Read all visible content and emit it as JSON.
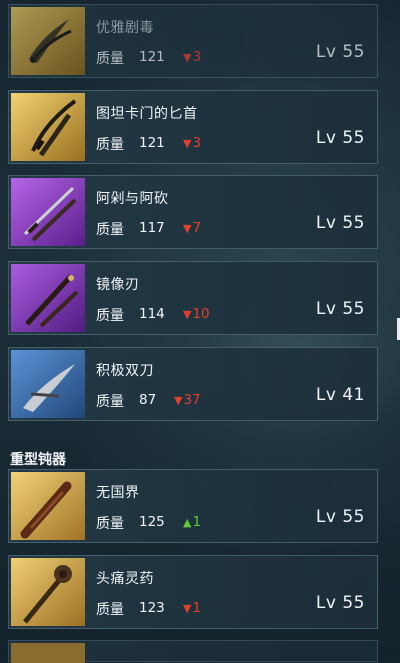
{
  "quality_label": "质量",
  "section_heavy_blunt": "重型钝器",
  "items": [
    {
      "name": "优雅剧毒",
      "quality": "121",
      "delta": "3",
      "delta_dir": "down",
      "level": "Lv 55",
      "rarity": "gold",
      "icon": "curved-dagger-icon"
    },
    {
      "name": "图坦卡门的匕首",
      "quality": "121",
      "delta": "3",
      "delta_dir": "down",
      "level": "Lv 55",
      "rarity": "gold",
      "icon": "twin-daggers-icon"
    },
    {
      "name": "阿剁与阿砍",
      "quality": "117",
      "delta": "7",
      "delta_dir": "down",
      "level": "Lv 55",
      "rarity": "purple",
      "icon": "twin-daggers-icon"
    },
    {
      "name": "镜像刃",
      "quality": "114",
      "delta": "10",
      "delta_dir": "down",
      "level": "Lv 55",
      "rarity": "purple",
      "icon": "twin-daggers-icon"
    },
    {
      "name": "积极双刀",
      "quality": "87",
      "delta": "37",
      "delta_dir": "down",
      "level": "Lv 41",
      "rarity": "blue",
      "icon": "curved-dagger-icon"
    },
    {
      "name": "无国界",
      "quality": "125",
      "delta": "1",
      "delta_dir": "up",
      "level": "Lv 55",
      "rarity": "gold",
      "icon": "club-icon"
    },
    {
      "name": "头痛灵药",
      "quality": "123",
      "delta": "1",
      "delta_dir": "down",
      "level": "Lv 55",
      "rarity": "gold",
      "icon": "scepter-icon"
    }
  ],
  "colors": {
    "gold": "#c9a23c",
    "purple": "#8a3fc4",
    "blue": "#3b6fb0",
    "delta_down": "#e0412f",
    "delta_up": "#63c83a"
  }
}
